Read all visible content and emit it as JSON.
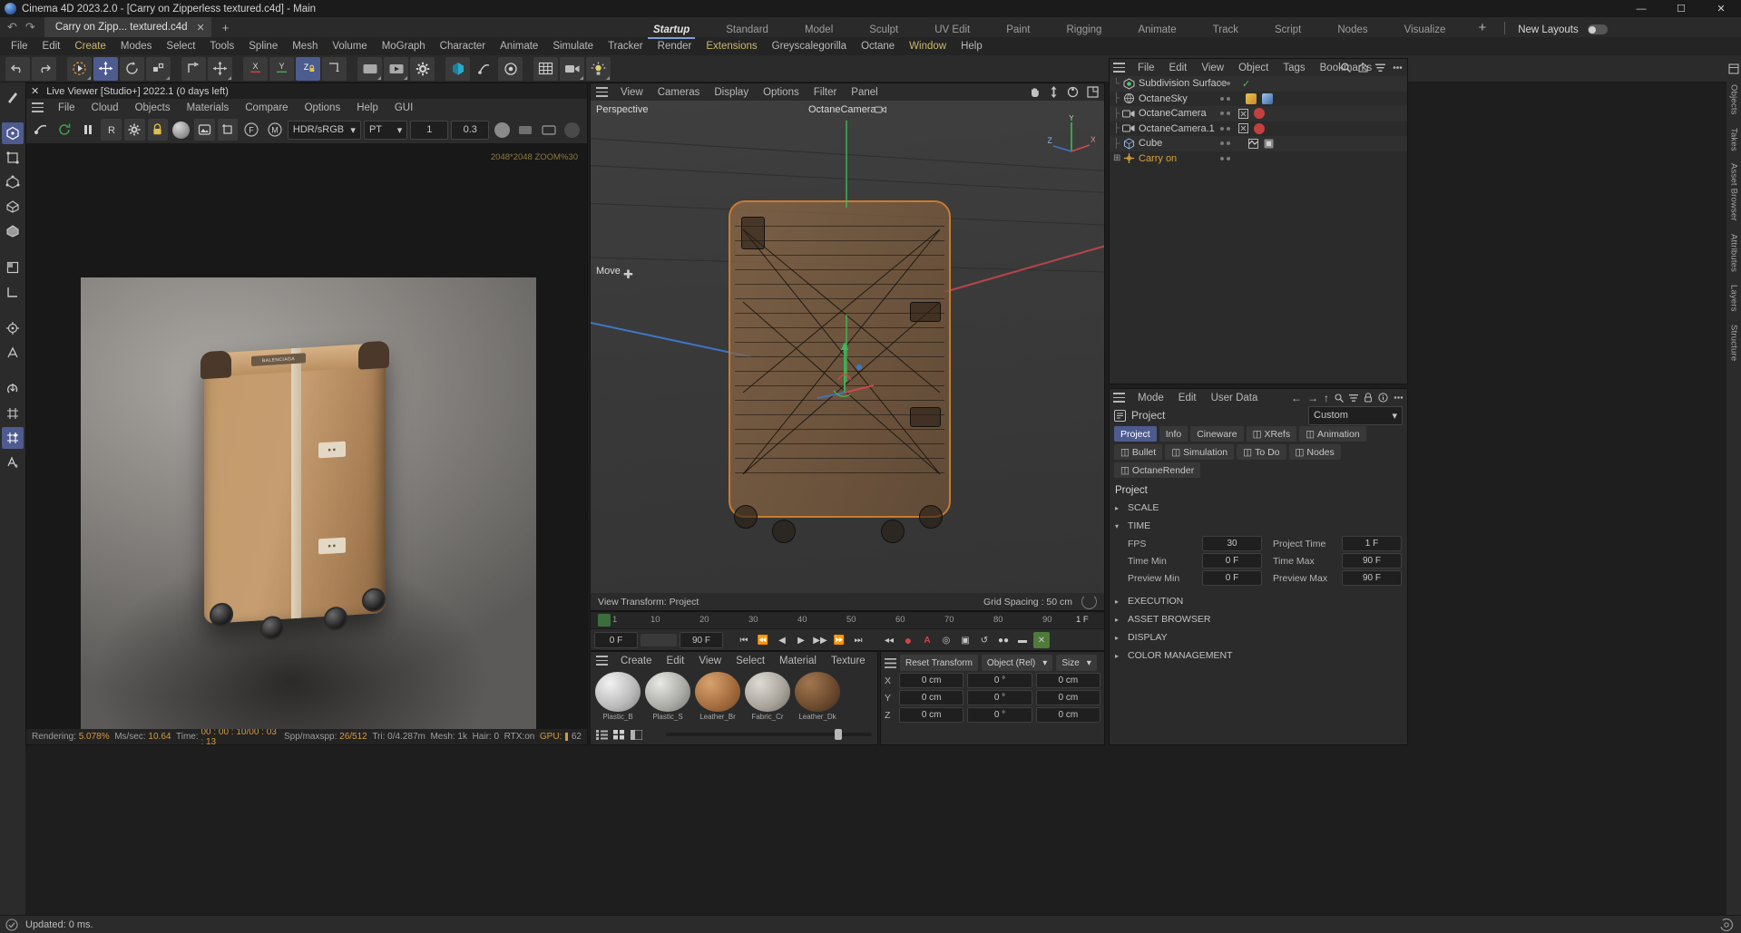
{
  "window": {
    "title": "Cinema 4D 2023.2.0 - [Carry on Zipperless textured.c4d] - Main",
    "minimize": "—",
    "maximize": "☐",
    "close": "✕"
  },
  "tabs": {
    "document": "Carry on Zipp... textured.c4d",
    "close": "✕",
    "add": "+",
    "undo": "↶",
    "redo": "↷"
  },
  "layouts": {
    "items": [
      "Startup",
      "Standard",
      "Model",
      "Sculpt",
      "UV Edit",
      "Paint",
      "Rigging",
      "Animate",
      "Track",
      "Script",
      "Nodes",
      "Visualize"
    ],
    "active": "Startup",
    "plus": "+",
    "new_layouts_label": "New Layouts"
  },
  "menubar": {
    "items": [
      "File",
      "Edit",
      "Create",
      "Modes",
      "Select",
      "Tools",
      "Spline",
      "Mesh",
      "Volume",
      "MoGraph",
      "Character",
      "Animate",
      "Simulate",
      "Tracker",
      "Render",
      "Extensions",
      "Greyscalegorilla",
      "Octane",
      "Window",
      "Help"
    ],
    "highlighted": [
      "Create",
      "Extensions",
      "Window"
    ]
  },
  "live_viewer": {
    "title": "Live Viewer [Studio+] 2022.1 (0 days left)",
    "close": "✕",
    "menu": [
      "File",
      "Cloud",
      "Objects",
      "Materials",
      "Compare",
      "Options",
      "Help",
      "GUI"
    ],
    "colorspace": "HDR/sRGB",
    "kernel": "PT",
    "field1": "1",
    "field2": "0.3",
    "resolution_note": "2048*2048 ZOOM%30",
    "status": {
      "rendering_label": "Rendering:",
      "rendering_value": "5.078%",
      "msec_label": "Ms/sec:",
      "msec_value": "10.64",
      "time_label": "Time:",
      "time_value": "00 : 00 : 10/00 : 03 : 13",
      "spp_label": "Spp/maxspp:",
      "spp_value": "26/512",
      "tri_label": "Tri:",
      "tri_value": "0/4.287m",
      "mesh_label": "Mesh:",
      "mesh_value": "1k",
      "hair_label": "Hair:",
      "hair_value": "0",
      "rtx_label": "RTX:on",
      "gpu_label": "GPU:",
      "gpu_value": "62"
    },
    "brand_label": "BALENCIAGA",
    "tag_label": "■ ■"
  },
  "viewport": {
    "menu": [
      "View",
      "Cameras",
      "Display",
      "Options",
      "Filter",
      "Panel"
    ],
    "view_name": "Perspective",
    "camera_name": "OctaneCamera",
    "tool_label": "Move",
    "view_transform": "View Transform: Project",
    "grid_spacing": "Grid Spacing : 50 cm",
    "axis_x": "X",
    "axis_y": "Y",
    "axis_z": "Z",
    "icons": [
      "hand-icon",
      "move-icon",
      "rotate-icon",
      "maximize-icon"
    ]
  },
  "timeline": {
    "ticks": [
      "1",
      "10",
      "20",
      "30",
      "40",
      "50",
      "60",
      "70",
      "80",
      "90"
    ],
    "current_frame_label": "1 F",
    "start_field": "0 F",
    "end_field": "90 F",
    "buttons": [
      "goto-start",
      "prev-key",
      "prev-frame",
      "play",
      "next-frame",
      "next-key",
      "goto-end"
    ]
  },
  "materials": {
    "menu": [
      "Create",
      "Edit",
      "View",
      "Select",
      "Material",
      "Texture"
    ],
    "items": [
      {
        "name": "Plastic_B",
        "color": "#cfcfcf"
      },
      {
        "name": "Plastic_S",
        "color": "#b9b9b5"
      },
      {
        "name": "Leather_Br",
        "color": "#b3784a"
      },
      {
        "name": "Fabric_Cr",
        "color": "#a9a9a4"
      },
      {
        "name": "Leather_Dk",
        "color": "#6e4e32"
      }
    ]
  },
  "coordinates": {
    "reset_label": "Reset Transform",
    "mode": "Object (Rel)",
    "size_label": "Size",
    "rows": [
      {
        "axis": "X",
        "pos": "0 cm",
        "rot": "0 °",
        "size": "0 cm"
      },
      {
        "axis": "Y",
        "pos": "0 cm",
        "rot": "0 °",
        "size": "0 cm"
      },
      {
        "axis": "Z",
        "pos": "0 cm",
        "rot": "0 °",
        "size": "0 cm"
      }
    ]
  },
  "object_manager": {
    "menu": [
      "File",
      "Edit",
      "View",
      "Object",
      "Tags",
      "Bookmarks"
    ],
    "items": [
      {
        "name": "Subdivision Surface",
        "icon": "subdivision-icon",
        "color": "#c9c9c9",
        "check": true
      },
      {
        "name": "OctaneSky",
        "icon": "sky-icon",
        "color": "#c9c9c9",
        "check": false
      },
      {
        "name": "OctaneCamera",
        "icon": "camera-icon",
        "color": "#c9c9c9",
        "check": false
      },
      {
        "name": "OctaneCamera.1",
        "icon": "camera-icon",
        "color": "#c9c9c9",
        "check": false
      },
      {
        "name": "Cube",
        "icon": "cube-icon",
        "color": "#c9c9c9",
        "check": false
      },
      {
        "name": "Carry on",
        "icon": "null-icon",
        "color": "#d6a23c",
        "check": false
      }
    ]
  },
  "attributes": {
    "menu": [
      "Mode",
      "Edit",
      "User Data"
    ],
    "header": "Project",
    "preset": "Custom",
    "tabs": [
      {
        "label": "Project",
        "selected": true
      },
      {
        "label": "Info",
        "selected": false
      },
      {
        "label": "Cineware",
        "selected": false
      },
      {
        "label": "XRefs",
        "selected": false
      },
      {
        "label": "Animation",
        "selected": false
      },
      {
        "label": "Bullet",
        "selected": false
      },
      {
        "label": "Simulation",
        "selected": false
      },
      {
        "label": "To Do",
        "selected": false
      },
      {
        "label": "Nodes",
        "selected": false
      },
      {
        "label": "OctaneRender",
        "selected": false
      }
    ],
    "title": "Project",
    "sections": [
      {
        "label": "SCALE",
        "open": false
      },
      {
        "label": "TIME",
        "open": true
      },
      {
        "label": "EXECUTION",
        "open": false
      },
      {
        "label": "ASSET BROWSER",
        "open": false
      },
      {
        "label": "DISPLAY",
        "open": false
      },
      {
        "label": "COLOR MANAGEMENT",
        "open": false
      }
    ],
    "time_rows": [
      {
        "l1": "FPS",
        "v1": "30",
        "l2": "Project Time",
        "v2": "1 F"
      },
      {
        "l1": "Time Min",
        "v1": "0 F",
        "l2": "Time Max",
        "v2": "90 F"
      },
      {
        "l1": "Preview Min",
        "v1": "0 F",
        "l2": "Preview Max",
        "v2": "90 F"
      }
    ]
  },
  "right_rail": {
    "tabs": [
      "Objects",
      "Takes",
      "Asset Browser",
      "Attributes",
      "Layers",
      "Structure"
    ]
  },
  "statusbar": {
    "text": "Updated: 0 ms."
  },
  "colors": {
    "accent": "#4d5b8f",
    "highlight_menu": "#c9b96b",
    "selected_object": "#d6a23c",
    "status_value": "#d69a3c"
  }
}
